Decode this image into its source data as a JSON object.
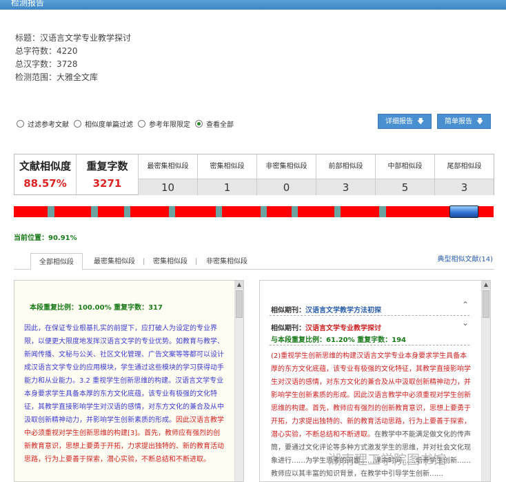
{
  "header": {
    "title": "检测报告"
  },
  "meta": {
    "title": "标题：汉语言文学专业教学探讨",
    "total_chars": "总字符数：4220",
    "total_hanzi": "总汉字数：3728",
    "scope": "检测范围：大雅全文库"
  },
  "filters": [
    {
      "label": "过滤参考文献",
      "checked": false
    },
    {
      "label": "相似度单篇过滤",
      "checked": false
    },
    {
      "label": "参考年限限定",
      "checked": false
    },
    {
      "label": "查看全部",
      "checked": true
    }
  ],
  "buttons": {
    "detail": "详细报告",
    "simple": "简单报告"
  },
  "stats": {
    "similarity_label": "文献相似度",
    "similarity_value": "88.57%",
    "repeat_label": "重复字数",
    "repeat_value": "3271",
    "cells": [
      {
        "label": "最密集相似段",
        "value": "10"
      },
      {
        "label": "密集相似段",
        "value": "1"
      },
      {
        "label": "非密集相似段",
        "value": "0"
      },
      {
        "label": "前部相似段",
        "value": "3"
      },
      {
        "label": "中部相似段",
        "value": "5"
      },
      {
        "label": "尾部相似段",
        "value": "3"
      }
    ]
  },
  "sim_bar": {
    "colors": {
      "hit": "#ff0000",
      "gap": "#6aa3a0"
    },
    "segments": [
      "hit",
      "gap",
      "hit",
      "gap",
      "hit",
      "gap",
      "hit",
      "gap",
      "hit",
      "gap",
      "hit",
      "gap",
      "hit",
      "gap",
      "hit",
      "gap",
      "hit",
      "gap",
      "hit"
    ],
    "current_fraction": 0.9091
  },
  "current_position": "当前位置：90.91%",
  "tabs": {
    "items": [
      "全部相似段",
      "最密集相似段",
      "密集相似段",
      "非密集相似段"
    ],
    "typical": "典型相似文献(14)"
  },
  "left_panel": {
    "heading": "本段重复比例：100.00% 重复字数：317",
    "text_blue": "因此，在保证专业根基扎实的前提下，应打破人为设定的专业界限，以便更大限度地发挥汉语言文学的专业优势。如教育与教学、新闻传播、文秘与公关、社区文化管理、广告文案等等都可以设计成汉语言文学专业的应用模块，学生通过这些模块的学习获得动手能力和从业能力。3.2 重视学生创新思维的构建。汉语言文学专业本身要求学生具备本厚的东方文化底蕴，该专业有极强的文化特征，其教学直接影响学生对汉语的感情，对东方文化的兼合及从中汲取创新精神动力，并影响学生创新素质的形成。",
    "text_red": "因此汉语言教学中必须重视对学生创新思维的构建[3]。首先，教师应有强烈的创新教育意识，思想上要勇于开拓，力求提出独特的、新的教育活动思路，行为上要善于探索，潜心实验，不断总结和不断进取。"
  },
  "right_panel": {
    "row1_label": "相似期刊：",
    "row1_title": "汉语言文学教学方法初探",
    "row2_label": "相似期刊：",
    "row2_title": "汉语言文学专业教学探讨",
    "row3": "与本段重复比例：61.20% 重复字数：194",
    "text_red": "(2)重视学生创新思维的构建汉语言文学专业本身要求学生具备本厚的东方文化底蕴，该专业有极强的文化特征，其教学直接影响学生对汉语的感情，对东方文化的兼合及从中汲取创新精神动力，并影响学生创新素质的形成。因此汉语言教学中必须重视对学生创新思维的构建。首先，教师应有强烈的创新教育意识，思想上要勇于开拓，力求提出独特的、新的教育活动思路，行为上要善于探索，潜心实验，不断总结和不断进取。",
    "text_gray": "在教学中不能满足做文化的传声筒，要通过文化评论等多种方式激发学生的思维，并对社会文化现象进行……为学生思考的问题……课余时间……培养学生创新……教师应以其丰富的知识背景，在教学中引导学生创新……",
    "watermark": "湖南理工学院图书馆"
  }
}
